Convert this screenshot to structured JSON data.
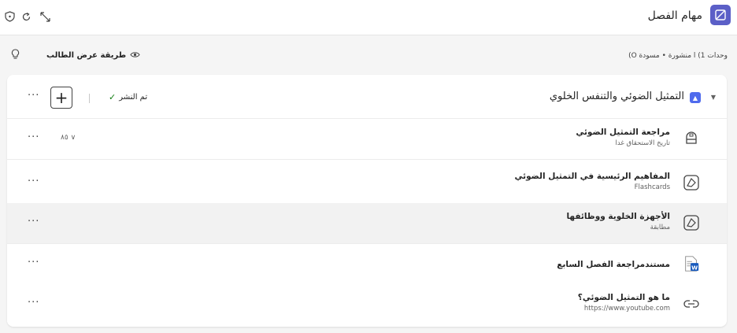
{
  "topbar": {
    "title": "مهام الفصل",
    "icons": [
      "expand-icon",
      "refresh-icon",
      "shield-icon",
      "app-logo-icon"
    ]
  },
  "subbar": {
    "student_view": "طريقة عرض الطالب",
    "status": "وحدات 1) ا منشورة • مسودة O)"
  },
  "section": {
    "title": "التمثيل الضوئي والتنفس الخلوي",
    "published_label": "تم النشر",
    "add_button": "+",
    "more": "···"
  },
  "items": [
    {
      "title": "مراجعة التمثيل الضوئي",
      "subtitle": "تاريخ الاستحقاق غدا",
      "icon": "assignment-icon",
      "points": "٨٥",
      "more": "···"
    },
    {
      "title": "المفاهيم الرئيسية في التمثيل الضوئي",
      "subtitle": "Flashcards",
      "icon": "learning-activity-icon",
      "more": "···"
    },
    {
      "title": "الأجهزة الخلوية ووظائفها",
      "subtitle": "مطابقة",
      "icon": "learning-activity-icon",
      "more": "···"
    },
    {
      "title": "مستندمراجعة الفصل السابع",
      "subtitle": "",
      "icon": "word-document-icon",
      "more": "···"
    },
    {
      "title": "ما هو التمثيل الضوئي؟",
      "subtitle": "https://www.youtube.com",
      "icon": "link-icon",
      "more": "···"
    }
  ],
  "colors": {
    "brand": "#5b5fc7",
    "published": "#107c10"
  }
}
